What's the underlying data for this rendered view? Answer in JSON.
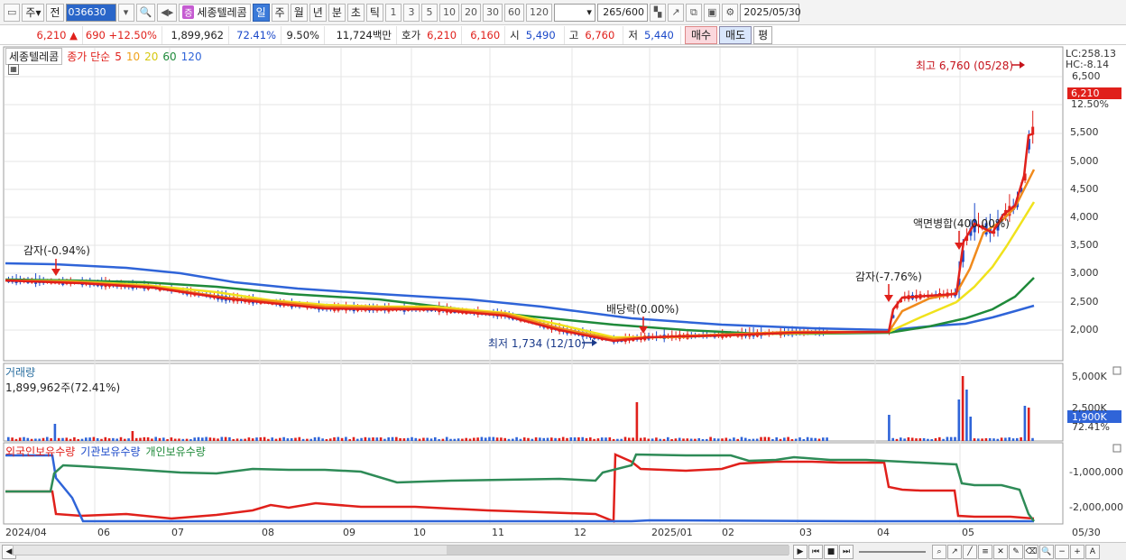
{
  "toolbar": {
    "period_select": "주",
    "prev_label": "전",
    "code": "036630",
    "stock_badge": "증",
    "stock_name": "세종텔레콤",
    "period_tabs": [
      "일",
      "주",
      "월",
      "년",
      "분",
      "초",
      "틱"
    ],
    "active_tab": "일",
    "interval_buttons": [
      "1",
      "3",
      "5",
      "10",
      "20",
      "30",
      "60",
      "120"
    ],
    "count_value": "265",
    "count_max": "/600",
    "date_value": "2025/05/30"
  },
  "quote": {
    "price": "6,210",
    "arrow": "▲",
    "change": "690",
    "change_pct": "+12.50%",
    "volume": "1,899,962",
    "volume_ratio": "72.41%",
    "turnover": "9.50%",
    "amount": "11,724백만",
    "hoga_label": "호가",
    "hoga_value": "6,210",
    "hoga_value2": "6,160",
    "open_label": "시",
    "open_value": "5,490",
    "high_label": "고",
    "high_value": "6,760",
    "low_label": "저",
    "low_value": "5,440",
    "buy_label": "매수",
    "sell_label": "매도",
    "eval_label": "평"
  },
  "legend": {
    "name": "세종텔레콤",
    "price_label": "종가 단순",
    "ma": [
      {
        "label": "5",
        "color": "#e0201b"
      },
      {
        "label": "10",
        "color": "#f08a1c"
      },
      {
        "label": "20",
        "color": "#f0e21c"
      },
      {
        "label": "60",
        "color": "#1f8a3a"
      },
      {
        "label": "120",
        "color": "#2f64d8"
      }
    ]
  },
  "price_axis": {
    "lc": "LC:258.13",
    "hc": "HC:-8.14",
    "ticks": [
      "6,500",
      "6,000",
      "5,500",
      "5,000",
      "4,500",
      "4,000",
      "3,500",
      "3,000",
      "2,500",
      "2,000"
    ],
    "current": "6,210",
    "current_pct": "12.50%"
  },
  "annotations": {
    "high": "최고 6,760 (05/28)",
    "low": "최저 1,734 (12/10)",
    "gamja1": "감자(-0.94%)",
    "gamja2": "감자(-7.76%)",
    "dividend": "배당락(0.00%)",
    "merge": "액면병합(400.00%)"
  },
  "volume_panel": {
    "title": "거래량",
    "value": "1,899,962주(72.41%)",
    "ticks": [
      "5,000K",
      "2,500K"
    ],
    "current": "1,900K",
    "current_pct": "72.41%"
  },
  "holdings_panel": {
    "series": [
      "외국인보유수량",
      "기관보유수량",
      "개인보유수량"
    ],
    "ticks": [
      "-1,000,000",
      "-2,000,000"
    ]
  },
  "x_axis": [
    "2024/04",
    "06",
    "07",
    "08",
    "09",
    "10",
    "11",
    "12",
    "2025/01",
    "02",
    "03",
    "04",
    "05",
    "05/30"
  ],
  "colors": {
    "up": "#e0201b",
    "down": "#1a48c9",
    "accent": "#3a7ad9"
  }
}
